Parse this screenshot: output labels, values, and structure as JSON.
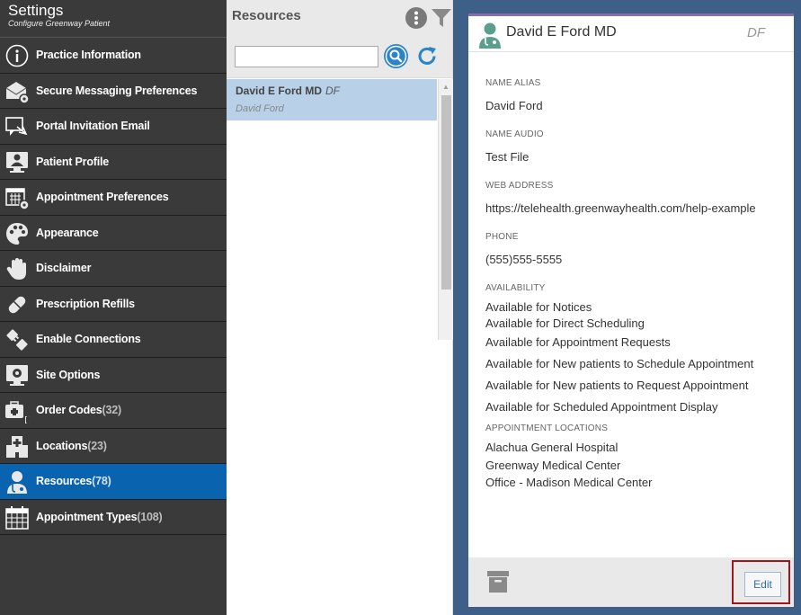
{
  "sidebar": {
    "title": "Settings",
    "subtitle": "Configure Greenway Patient",
    "items": [
      {
        "label": "Practice Information",
        "count": ""
      },
      {
        "label": "Secure Messaging Preferences",
        "count": ""
      },
      {
        "label": "Portal Invitation Email",
        "count": ""
      },
      {
        "label": "Patient Profile",
        "count": ""
      },
      {
        "label": "Appointment Preferences",
        "count": ""
      },
      {
        "label": "Appearance",
        "count": ""
      },
      {
        "label": "Disclaimer",
        "count": ""
      },
      {
        "label": "Prescription Refills",
        "count": ""
      },
      {
        "label": "Enable Connections",
        "count": ""
      },
      {
        "label": "Site Options",
        "count": ""
      },
      {
        "label": "Order Codes",
        "count": "(32)"
      },
      {
        "label": "Locations",
        "count": "(23)"
      },
      {
        "label": "Resources",
        "count": "(78)"
      },
      {
        "label": "Appointment Types",
        "count": "(108)"
      }
    ]
  },
  "list": {
    "title": "Resources",
    "search_value": "",
    "items": [
      {
        "name": "David E Ford MD",
        "initials": "DF",
        "alias": "David Ford"
      }
    ]
  },
  "detail": {
    "name": "David E Ford MD",
    "initials": "DF",
    "fields": {
      "name_alias_label": "NAME ALIAS",
      "name_alias": "David Ford",
      "name_audio_label": "NAME AUDIO",
      "name_audio": "Test File",
      "web_label": "WEB ADDRESS",
      "web": "https://telehealth.greenwayhealth.com/help-example",
      "phone_label": "PHONE",
      "phone": "(555)555-5555",
      "availability_label": "AVAILABILITY",
      "availability": [
        "Available for Notices",
        "Available for Direct Scheduling",
        "Available for Appointment Requests",
        "Available for New patients to Schedule Appointment",
        "Available for New patients to Request Appointment",
        "Available for Scheduled Appointment Display"
      ],
      "locations_label": "APPOINTMENT LOCATIONS",
      "locations": [
        "Alachua General Hospital",
        "Greenway Medical Center",
        "Office - Madison Medical Center"
      ]
    },
    "edit_label": "Edit"
  },
  "colors": {
    "sidebar_bg": "#3a3a3a",
    "active_item": "#0a63ae",
    "selected_row": "#b8d1e8",
    "detail_bg": "#3d5f88",
    "card_accent": "#8a6bab",
    "highlight": "#a0161c"
  }
}
